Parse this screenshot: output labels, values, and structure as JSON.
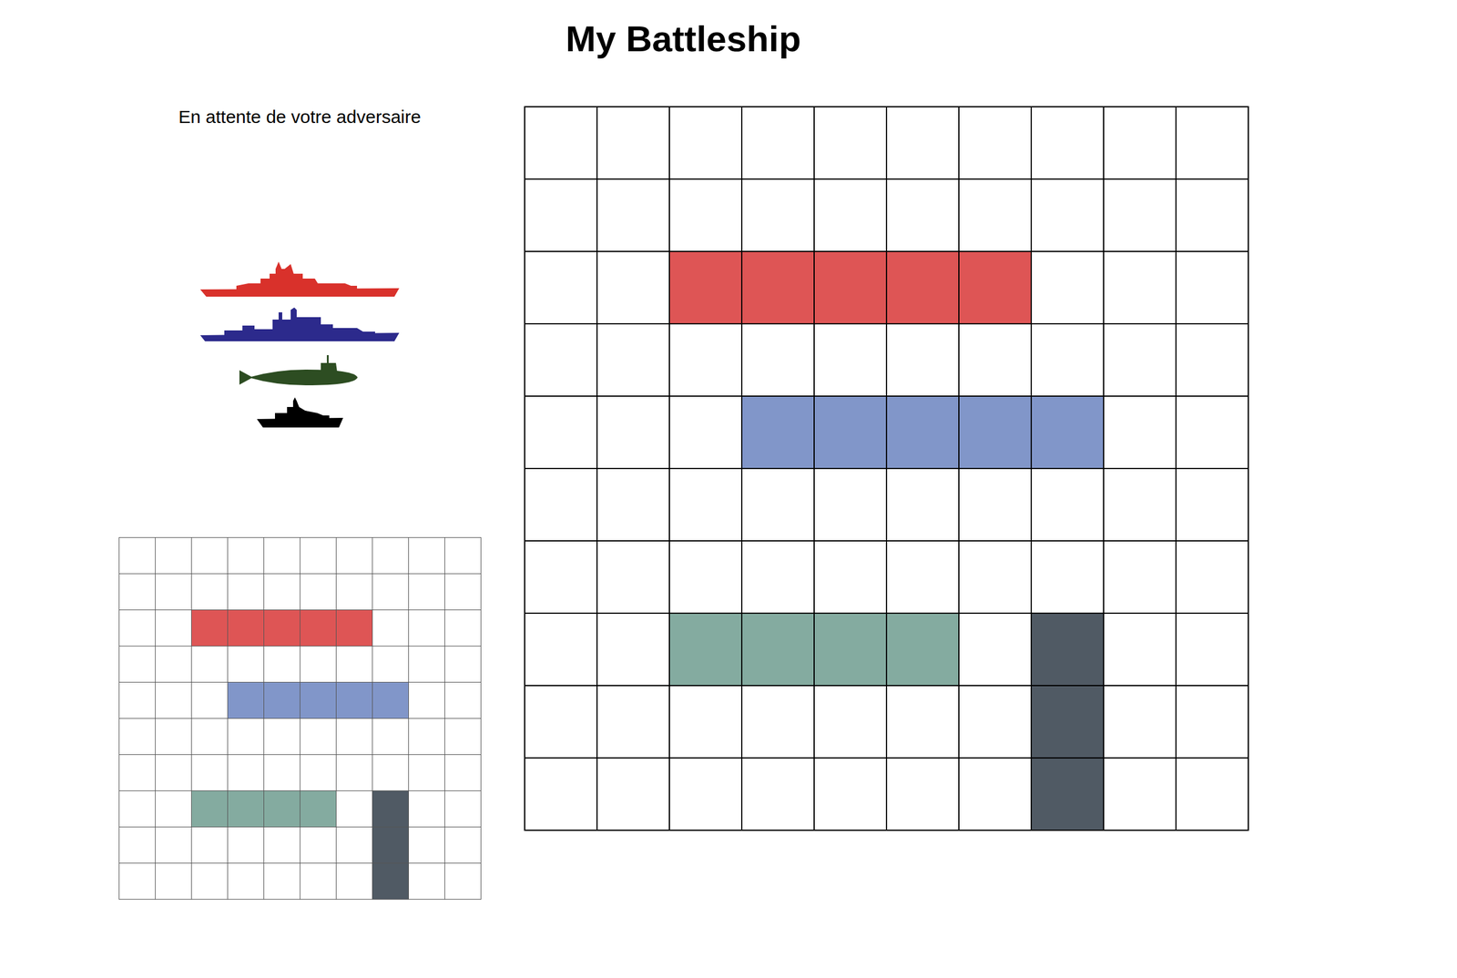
{
  "title": "My Battleship",
  "status": "En attente de votre adversaire",
  "fleet": [
    {
      "kind": "battleship",
      "color": "#d9312b"
    },
    {
      "kind": "cruiser",
      "color": "#2c2a8c"
    },
    {
      "kind": "submarine",
      "color": "#2d4d22"
    },
    {
      "kind": "patrol",
      "color": "#000000"
    }
  ],
  "board": {
    "rows": 10,
    "cols": 10,
    "ships": [
      {
        "row": 2,
        "col": 2,
        "length": 5,
        "vertical": false,
        "color": "#de5555"
      },
      {
        "row": 4,
        "col": 3,
        "length": 5,
        "vertical": false,
        "color": "#8196c9"
      },
      {
        "row": 7,
        "col": 2,
        "length": 4,
        "vertical": false,
        "color": "#84aba0"
      },
      {
        "row": 7,
        "col": 7,
        "length": 3,
        "vertical": true,
        "color": "#505a64"
      }
    ]
  }
}
